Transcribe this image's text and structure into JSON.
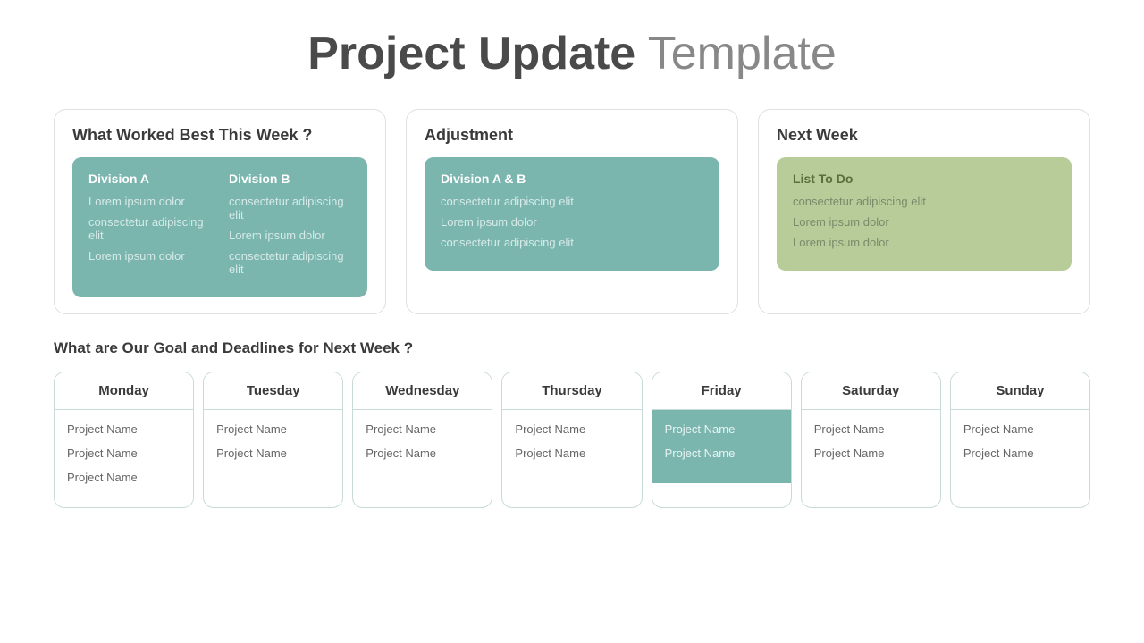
{
  "title": {
    "bold": "Project Update",
    "light": " Template"
  },
  "cards": {
    "worked": {
      "title": "What Worked Best This Week ?",
      "col_a_header": "Division A",
      "col_a_items": [
        "Lorem ipsum dolor",
        "consectetur adipiscing elit",
        "Lorem ipsum dolor"
      ],
      "col_b_header": "Division B",
      "col_b_items": [
        "consectetur adipiscing elit",
        "Lorem ipsum dolor",
        "consectetur adipiscing elit"
      ]
    },
    "adjustment": {
      "title": "Adjustment",
      "header": "Division A & B",
      "items": [
        "consectetur adipiscing elit",
        "Lorem ipsum dolor",
        "consectetur adipiscing elit"
      ]
    },
    "nextweek": {
      "title": "Next Week",
      "header": "List To Do",
      "items": [
        "consectetur adipiscing elit",
        "Lorem ipsum dolor",
        "Lorem ipsum dolor"
      ]
    }
  },
  "goals_title": "What are Our Goal and Deadlines for Next Week ?",
  "days": [
    {
      "name": "Monday",
      "projects": [
        "Project Name",
        "Project Name",
        "Project Name"
      ],
      "highlighted": false
    },
    {
      "name": "Tuesday",
      "projects": [
        "Project Name",
        "Project Name"
      ],
      "highlighted": false
    },
    {
      "name": "Wednesday",
      "projects": [
        "Project Name",
        "Project Name"
      ],
      "highlighted": false
    },
    {
      "name": "Thursday",
      "projects": [
        "Project Name",
        "Project Name"
      ],
      "highlighted": false
    },
    {
      "name": "Friday",
      "projects": [
        "Project Name",
        "Project Name"
      ],
      "highlighted": true
    },
    {
      "name": "Saturday",
      "projects": [
        "Project Name",
        "Project Name"
      ],
      "highlighted": false
    },
    {
      "name": "Sunday",
      "projects": [
        "Project Name",
        "Project Name"
      ],
      "highlighted": false
    }
  ]
}
